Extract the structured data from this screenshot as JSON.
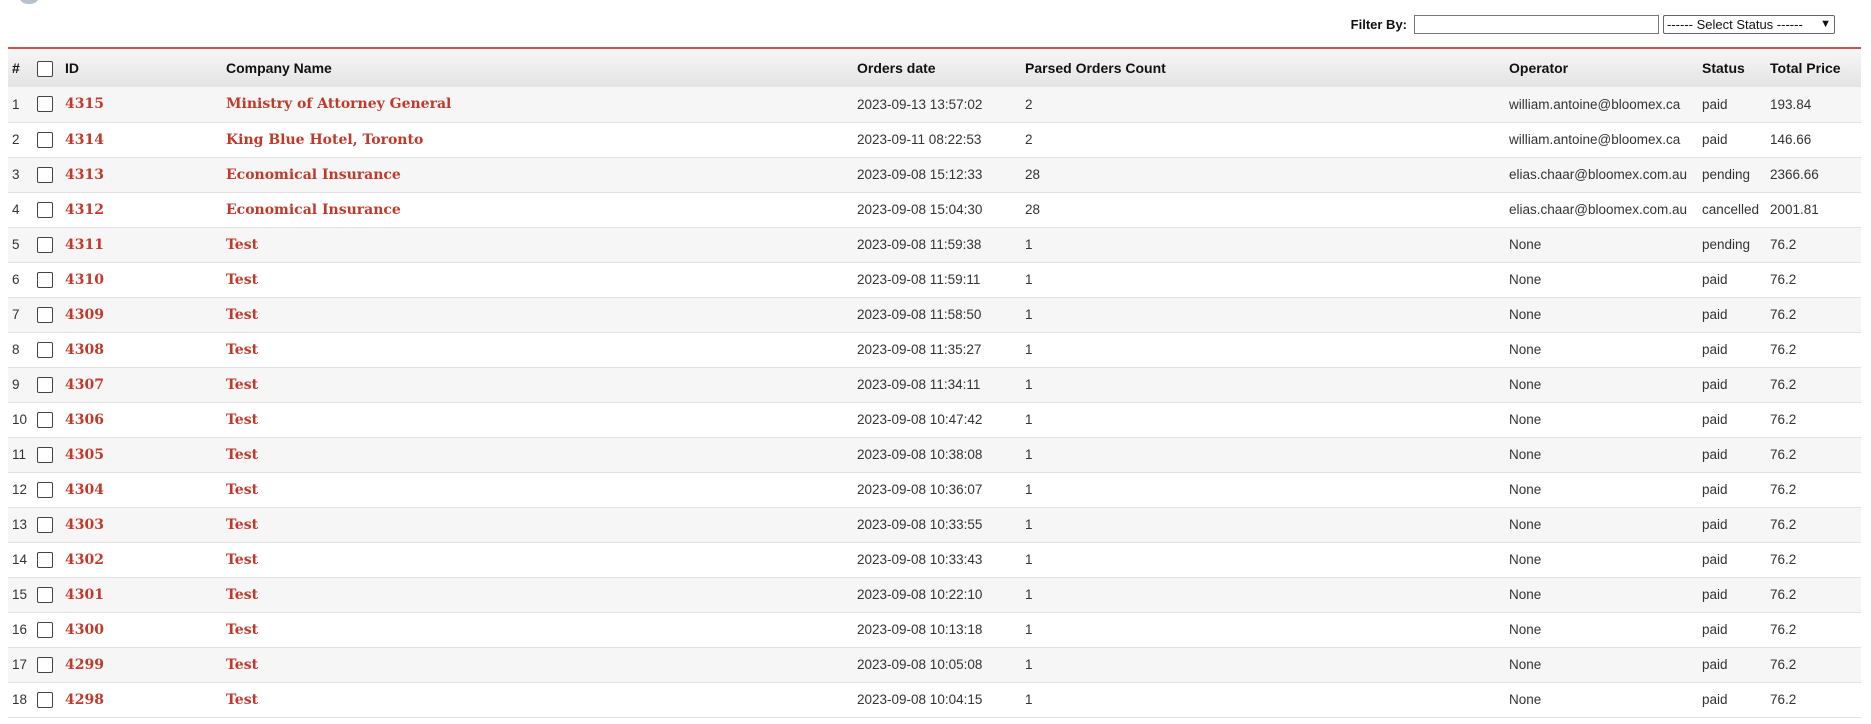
{
  "filter": {
    "label": "Filter By:",
    "value": "",
    "status_select": "------ Select Status ------"
  },
  "columns": [
    "#",
    "ID",
    "Company Name",
    "Orders date",
    "Parsed Orders Count",
    "Operator",
    "Status",
    "Total Price"
  ],
  "rows": [
    {
      "num": "1",
      "id": "4315",
      "company": "Ministry of Attorney General",
      "date": "2023-09-13 13:57:02",
      "count": "2",
      "operator": "william.antoine@bloomex.ca",
      "status": "paid",
      "price": "193.84"
    },
    {
      "num": "2",
      "id": "4314",
      "company": "King Blue Hotel, Toronto",
      "date": "2023-09-11 08:22:53",
      "count": "2",
      "operator": "william.antoine@bloomex.ca",
      "status": "paid",
      "price": "146.66"
    },
    {
      "num": "3",
      "id": "4313",
      "company": "Economical Insurance",
      "date": "2023-09-08 15:12:33",
      "count": "28",
      "operator": "elias.chaar@bloomex.com.au",
      "status": "pending",
      "price": "2366.66"
    },
    {
      "num": "4",
      "id": "4312",
      "company": "Economical Insurance",
      "date": "2023-09-08 15:04:30",
      "count": "28",
      "operator": "elias.chaar@bloomex.com.au",
      "status": "cancelled",
      "price": "2001.81"
    },
    {
      "num": "5",
      "id": "4311",
      "company": "Test",
      "date": "2023-09-08 11:59:38",
      "count": "1",
      "operator": "None",
      "status": "pending",
      "price": "76.2"
    },
    {
      "num": "6",
      "id": "4310",
      "company": "Test",
      "date": "2023-09-08 11:59:11",
      "count": "1",
      "operator": "None",
      "status": "paid",
      "price": "76.2"
    },
    {
      "num": "7",
      "id": "4309",
      "company": "Test",
      "date": "2023-09-08 11:58:50",
      "count": "1",
      "operator": "None",
      "status": "paid",
      "price": "76.2"
    },
    {
      "num": "8",
      "id": "4308",
      "company": "Test",
      "date": "2023-09-08 11:35:27",
      "count": "1",
      "operator": "None",
      "status": "paid",
      "price": "76.2"
    },
    {
      "num": "9",
      "id": "4307",
      "company": "Test",
      "date": "2023-09-08 11:34:11",
      "count": "1",
      "operator": "None",
      "status": "paid",
      "price": "76.2"
    },
    {
      "num": "10",
      "id": "4306",
      "company": "Test",
      "date": "2023-09-08 10:47:42",
      "count": "1",
      "operator": "None",
      "status": "paid",
      "price": "76.2"
    },
    {
      "num": "11",
      "id": "4305",
      "company": "Test",
      "date": "2023-09-08 10:38:08",
      "count": "1",
      "operator": "None",
      "status": "paid",
      "price": "76.2"
    },
    {
      "num": "12",
      "id": "4304",
      "company": "Test",
      "date": "2023-09-08 10:36:07",
      "count": "1",
      "operator": "None",
      "status": "paid",
      "price": "76.2"
    },
    {
      "num": "13",
      "id": "4303",
      "company": "Test",
      "date": "2023-09-08 10:33:55",
      "count": "1",
      "operator": "None",
      "status": "paid",
      "price": "76.2"
    },
    {
      "num": "14",
      "id": "4302",
      "company": "Test",
      "date": "2023-09-08 10:33:43",
      "count": "1",
      "operator": "None",
      "status": "paid",
      "price": "76.2"
    },
    {
      "num": "15",
      "id": "4301",
      "company": "Test",
      "date": "2023-09-08 10:22:10",
      "count": "1",
      "operator": "None",
      "status": "paid",
      "price": "76.2"
    },
    {
      "num": "16",
      "id": "4300",
      "company": "Test",
      "date": "2023-09-08 10:13:18",
      "count": "1",
      "operator": "None",
      "status": "paid",
      "price": "76.2"
    },
    {
      "num": "17",
      "id": "4299",
      "company": "Test",
      "date": "2023-09-08 10:05:08",
      "count": "1",
      "operator": "None",
      "status": "paid",
      "price": "76.2"
    },
    {
      "num": "18",
      "id": "4298",
      "company": "Test",
      "date": "2023-09-08 10:04:15",
      "count": "1",
      "operator": "None",
      "status": "paid",
      "price": "76.2"
    }
  ]
}
